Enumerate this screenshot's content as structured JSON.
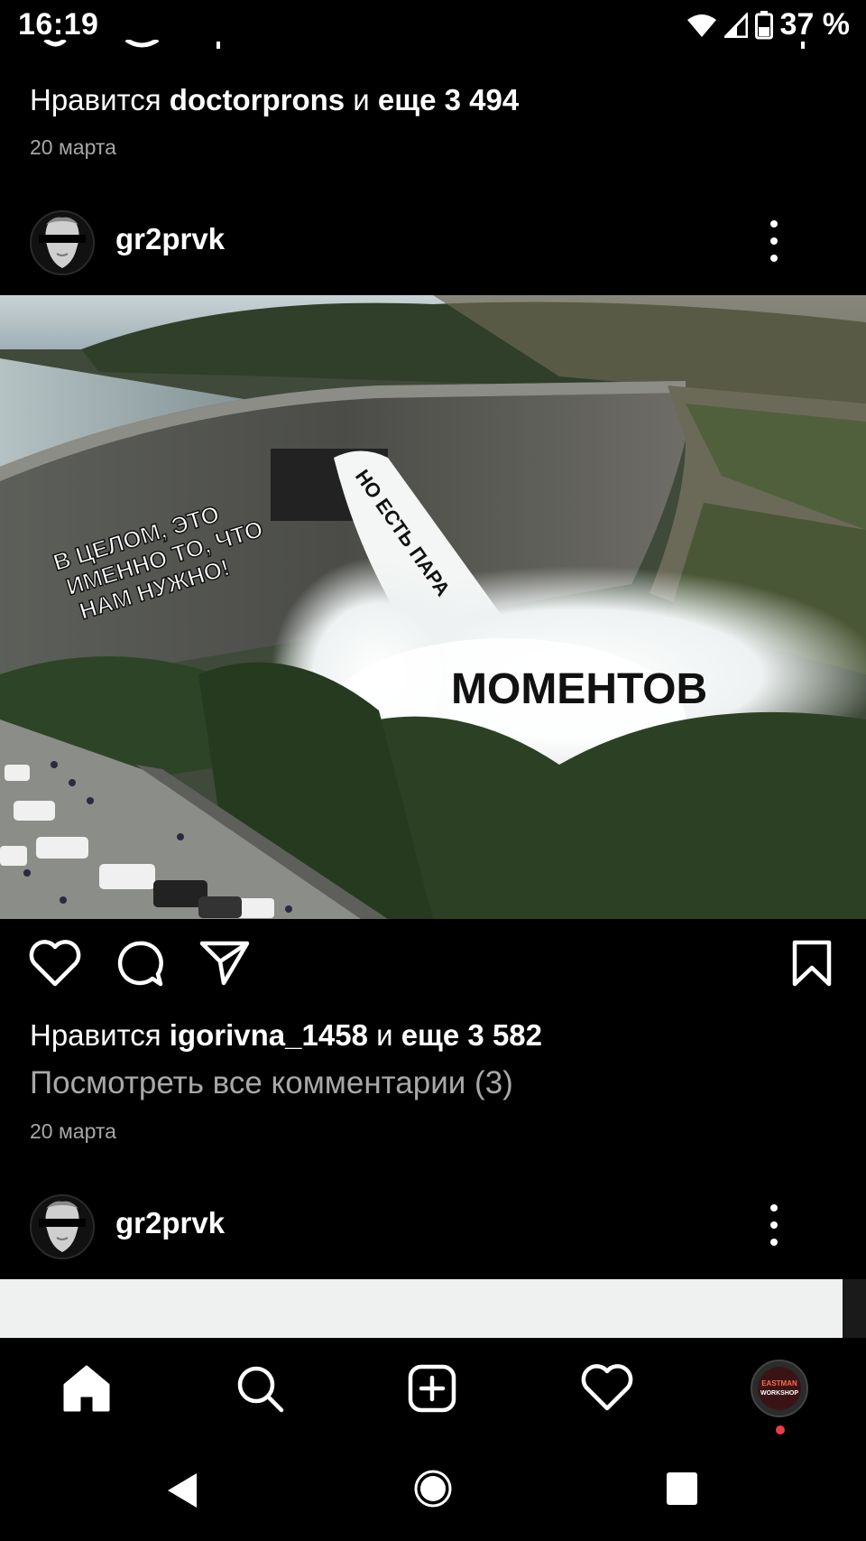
{
  "status_bar": {
    "time": "16:19",
    "battery": "37 %"
  },
  "previous_post": {
    "likes_prefix": "Нравится",
    "likes_user": "doctorprons",
    "likes_mid": "и",
    "likes_rest": "еще 3 494",
    "date": "20 марта"
  },
  "post": {
    "username": "gr2prvk",
    "image_text": {
      "left_caption": [
        "В ЦЕЛОМ, ЭТО",
        "ИМЕННО ТО, ЧТО",
        "НАМ НУЖНО!"
      ],
      "stream_caption": "НО ЕСТЬ ПАРА",
      "bottom_caption": "МОМЕНТОВ"
    },
    "likes_prefix": "Нравится",
    "likes_user": "igorivna_1458",
    "likes_mid": "и",
    "likes_rest": "еще 3 582",
    "view_comments": "Посмотреть все комментарии (3)",
    "date": "20 марта"
  },
  "next_post": {
    "username": "gr2prvk"
  },
  "bottom_nav": {
    "items": [
      "home-icon",
      "search-icon",
      "new-post-icon",
      "activity-heart-icon",
      "profile-avatar"
    ],
    "profile_avatar_text": [
      "EASTMAN",
      "WORKSHOP"
    ]
  },
  "colors": {
    "background": "#000000",
    "secondary_text": "#a8a8a8",
    "notification_dot": "#ee3b4a"
  }
}
